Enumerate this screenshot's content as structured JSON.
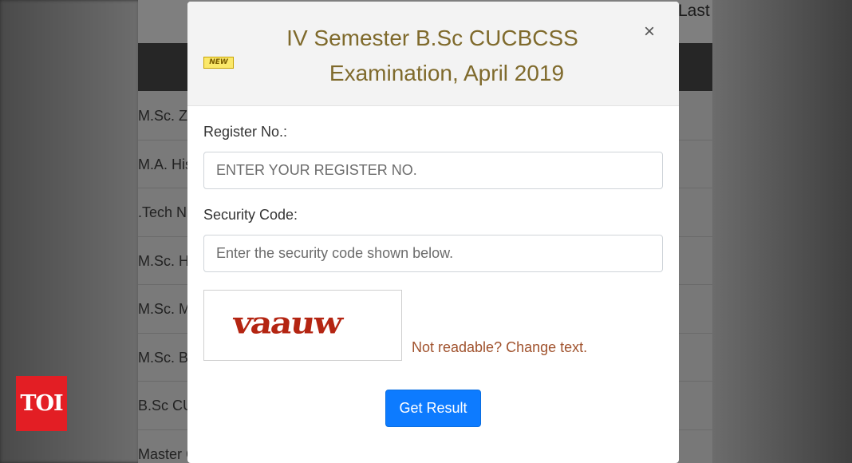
{
  "background": {
    "top_right_text": "Last",
    "list_items": [
      "M.Sc. Zo",
      "M.A. His",
      ".Tech N",
      "M.Sc. Hu",
      "M.Sc. Mi",
      "M.Sc. Bic",
      "B.Sc CU",
      "Master C"
    ]
  },
  "modal": {
    "badge": "NEW",
    "title_line1": "IV Semester B.Sc CUCBCSS",
    "title_line2": "Examination, April 2019",
    "close_symbol": "×",
    "register_label": "Register No.:",
    "register_placeholder": "ENTER YOUR REGISTER NO.",
    "register_value": "",
    "security_label": "Security Code:",
    "security_placeholder": "Enter the security code shown below.",
    "security_value": "",
    "captcha_text": "vaauw",
    "change_link": "Not readable? Change text.",
    "submit_label": "Get Result"
  },
  "watermark": {
    "logo_text": "TOI"
  },
  "colors": {
    "title": "#7f6a2c",
    "link": "#a0522d",
    "button": "#0d7bff",
    "captcha": "#b42512",
    "watermark": "#e31e24"
  }
}
